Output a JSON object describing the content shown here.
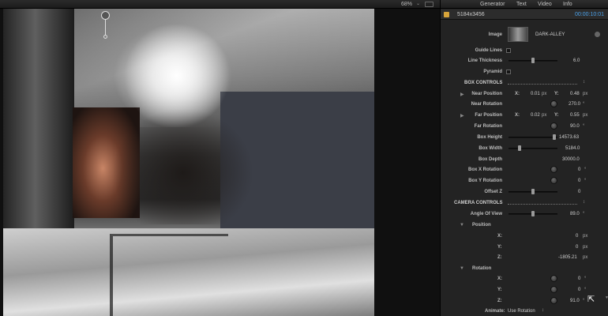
{
  "viewer": {
    "zoom": "68%",
    "zoom_chevron": "⌄"
  },
  "inspector": {
    "tabs": [
      "Generator",
      "Text",
      "Video",
      "Info"
    ],
    "resolution": "5184x3456",
    "timecode": "00:00:10:01",
    "image_label": "Image",
    "image_name": "DARK-ALLEY",
    "guide_lines_label": "Guide Lines",
    "line_thickness_label": "Line Thickness",
    "line_thickness_value": "6.0",
    "pyramid_label": "Pyramid",
    "box_controls_label": "BOX CONTROLS",
    "near_position_label": "Near Position",
    "near_x_label": "X:",
    "near_x_value": "0.01",
    "near_x_unit": "px",
    "near_y_label": "Y:",
    "near_y_value": "0.48",
    "near_y_unit": "px",
    "near_rotation_label": "Near Rotation",
    "near_rotation_value": "270.0",
    "near_rotation_unit": "°",
    "far_position_label": "Far Position",
    "far_x_label": "X:",
    "far_x_value": "0.02",
    "far_x_unit": "px",
    "far_y_label": "Y:",
    "far_y_value": "0.55",
    "far_y_unit": "px",
    "far_rotation_label": "Far Rotation",
    "far_rotation_value": "90.0",
    "far_rotation_unit": "°",
    "box_height_label": "Box Height",
    "box_height_value": "14573.63",
    "box_width_label": "Box Width",
    "box_width_value": "5184.0",
    "box_depth_label": "Box Depth",
    "box_depth_value": "30000.0",
    "box_x_rotation_label": "Box X Rotation",
    "box_x_rotation_value": "0",
    "box_x_rotation_unit": "°",
    "box_y_rotation_label": "Box Y Rotation",
    "box_y_rotation_value": "0",
    "box_y_rotation_unit": "°",
    "offset_z_label": "Offset Z",
    "offset_z_value": "0",
    "camera_controls_label": "CAMERA CONTROLS",
    "angle_of_view_label": "Angle Of View",
    "angle_of_view_value": "89.0",
    "angle_of_view_unit": "°",
    "position_label": "Position",
    "pos_x_label": "X:",
    "pos_x_value": "0",
    "pos_x_unit": "px",
    "pos_y_label": "Y:",
    "pos_y_value": "0",
    "pos_y_unit": "px",
    "pos_z_label": "Z:",
    "pos_z_value": "-1805.21",
    "pos_z_unit": "px",
    "rotation_label": "Rotation",
    "rot_x_label": "X:",
    "rot_x_value": "0",
    "rot_x_unit": "°",
    "rot_y_label": "Y:",
    "rot_y_value": "0",
    "rot_y_unit": "°",
    "rot_z_label": "Z:",
    "rot_z_value": "91.0",
    "rot_z_unit": "°",
    "animate_label": "Animate:",
    "animate_value": "Use Rotation"
  },
  "levels": {
    "line_thickness": 0.5,
    "box_height": 0.97,
    "box_width": 0.2,
    "offset_z": 0.5,
    "angle_of_view": 0.5
  }
}
